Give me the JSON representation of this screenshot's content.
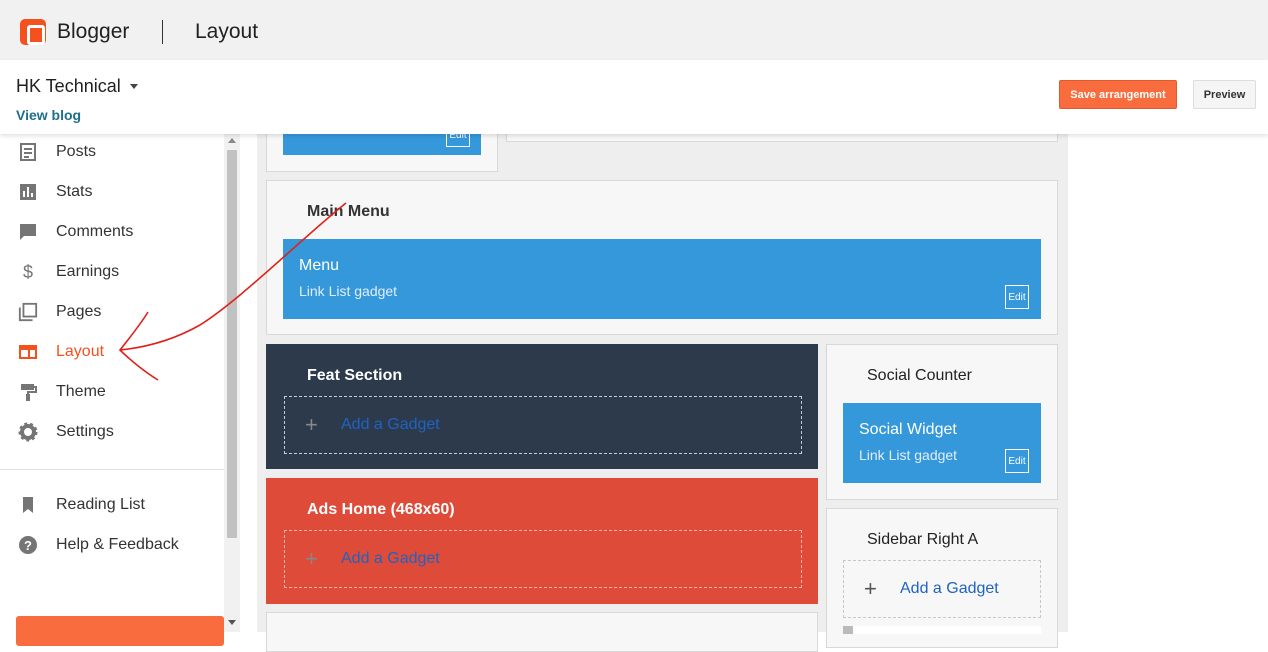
{
  "header": {
    "brand": "Blogger",
    "page_title": "Layout"
  },
  "blog": {
    "title": "HK Technical",
    "view_blog": "View blog"
  },
  "actions": {
    "save_label": "Save arrangement",
    "preview_label": "Preview"
  },
  "sidebar": {
    "items": [
      {
        "label": "Posts",
        "icon": "posts-icon"
      },
      {
        "label": "Stats",
        "icon": "stats-icon"
      },
      {
        "label": "Comments",
        "icon": "comments-icon"
      },
      {
        "label": "Earnings",
        "icon": "dollar-icon"
      },
      {
        "label": "Pages",
        "icon": "pages-icon"
      },
      {
        "label": "Layout",
        "icon": "layout-icon",
        "active": true
      },
      {
        "label": "Theme",
        "icon": "paint-roller-icon"
      },
      {
        "label": "Settings",
        "icon": "gear-icon"
      }
    ],
    "secondary": [
      {
        "label": "Reading List",
        "icon": "bookmark-icon"
      },
      {
        "label": "Help & Feedback",
        "icon": "help-icon"
      }
    ]
  },
  "layout": {
    "top_gadget_edit": "Edit",
    "main_menu": {
      "title": "Main Menu",
      "gadget": {
        "name": "Menu",
        "type": "Link List gadget",
        "edit": "Edit"
      }
    },
    "feat_section": {
      "title": "Feat Section",
      "add_label": "Add a Gadget",
      "color": "#2c3a4c"
    },
    "ads_home": {
      "title": "Ads Home (468x60)",
      "add_label": "Add a Gadget",
      "color": "#de4b39"
    },
    "social_counter": {
      "title": "Social Counter",
      "gadget": {
        "name": "Social Widget",
        "type": "Link List gadget",
        "edit": "Edit"
      }
    },
    "sidebar_right_a": {
      "title": "Sidebar Right A",
      "add_label": "Add a Gadget"
    }
  },
  "colors": {
    "accent": "#f4511e",
    "gadget_blue": "#3498db",
    "annotation": "#e0201b"
  }
}
